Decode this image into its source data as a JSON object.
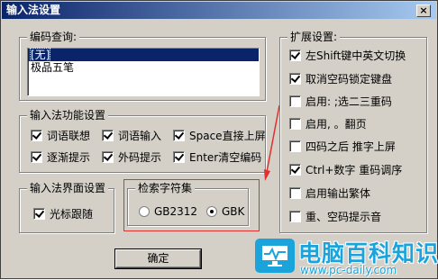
{
  "window": {
    "title": "输入法设置",
    "close_glyph": "×"
  },
  "code_query": {
    "legend": "编码查询:",
    "items": [
      {
        "label": "[无]",
        "selected": true
      },
      {
        "label": "极品五笔",
        "selected": false
      }
    ]
  },
  "features": {
    "legend": "输入法功能设置",
    "items": [
      {
        "label": "词语联想",
        "checked": true
      },
      {
        "label": "词语输入",
        "checked": true
      },
      {
        "label": "Space直接上屏",
        "checked": true
      },
      {
        "label": "逐渐提示",
        "checked": true
      },
      {
        "label": "外码提示",
        "checked": true
      },
      {
        "label": "Enter清空编码",
        "checked": true
      }
    ]
  },
  "ui_settings": {
    "legend": "输入法界面设置",
    "cursor_follow": {
      "label": "光标跟随",
      "checked": true
    }
  },
  "charset": {
    "legend": "检索字符集",
    "options": [
      {
        "label": "GB2312",
        "selected": false
      },
      {
        "label": "GBK",
        "selected": true
      }
    ]
  },
  "extended": {
    "legend": "扩展设置:",
    "items": [
      {
        "label": "左Shift键中英文切换",
        "checked": true
      },
      {
        "label": "取消空码锁定键盘",
        "checked": true
      },
      {
        "label": "启用: ;选二三重码",
        "checked": false
      },
      {
        "label": "启用, 。翻页",
        "checked": false
      },
      {
        "label": "四码之后  推字上屏",
        "checked": false
      },
      {
        "label": "Ctrl+数字 重码调序",
        "checked": true
      },
      {
        "label": "启用输出繁体",
        "checked": false
      },
      {
        "label": "重、空码提示音",
        "checked": false
      }
    ]
  },
  "buttons": {
    "ok": "确定"
  },
  "watermark": {
    "title": "电脑百科知识",
    "url": "www.pc-daily.com"
  },
  "colors": {
    "title_bar": "#0a246a",
    "highlight": "#e03030",
    "watermark": "#1ba4dc"
  }
}
